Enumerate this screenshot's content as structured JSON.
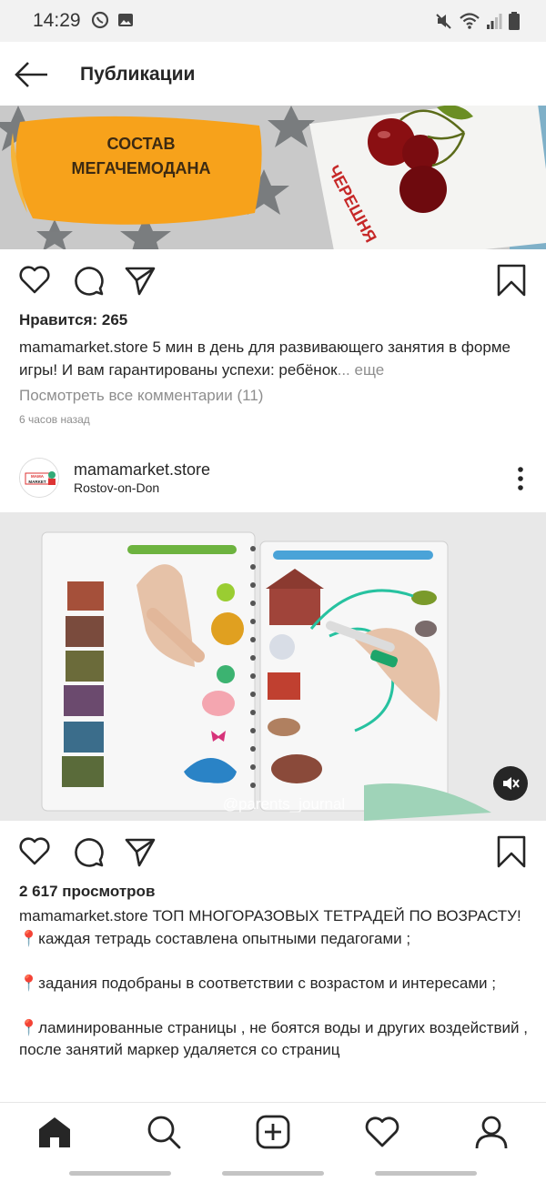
{
  "status_bar": {
    "time": "14:29",
    "left_icons": [
      "whatsapp-icon",
      "gallery-icon"
    ],
    "right_icons": [
      "mute-icon",
      "wifi-icon",
      "signal-icon",
      "battery-icon"
    ]
  },
  "header": {
    "title": "Публикации",
    "back_icon": "arrow-left-icon"
  },
  "post1": {
    "image_banner_text": "СОСТАВ МЕГАЧЕМОДАНА",
    "image_card_text": "ЧЕРЕШНЯ",
    "likes": "Нравится: 265",
    "username": "mamamarket.store",
    "caption": "5 мин в день для развивающего занятия в форме игры! И вам гарантированы успехи: ребёнок",
    "more": "... еще",
    "view_comments": "Посмотреть все комментарии (11)",
    "time_ago": "6 часов назад"
  },
  "post2": {
    "avatar_label": "MAMA MARKET",
    "username": "mamamarket.store",
    "location": "Rostov-on-Don",
    "video_watermark": "@parents_journal",
    "views": "2 617 просмотров",
    "caption_username": "mamamarket.store",
    "caption_first": "ТОП МНОГОРАЗОВЫХ ТЕТРАДЕЙ ПО ВОЗРАСТУ!",
    "caption_lines": [
      "📍каждая тетрадь составлена опытными педагогами ;",
      "",
      "📍задания подобраны в соответствии с возрастом и интересами ;",
      "",
      "📍ламинированные страницы , не боятся воды и других воздействий , после занятий маркер удаляется со страниц"
    ]
  },
  "bottom_nav": [
    "home-icon",
    "search-icon",
    "add-post-icon",
    "activity-heart-icon",
    "profile-icon"
  ],
  "colors": {
    "status_bar_bg": "#f2f2f2",
    "text_primary": "#262626",
    "text_secondary": "#8e8e8e",
    "banner_orange": "#f7a21b"
  }
}
